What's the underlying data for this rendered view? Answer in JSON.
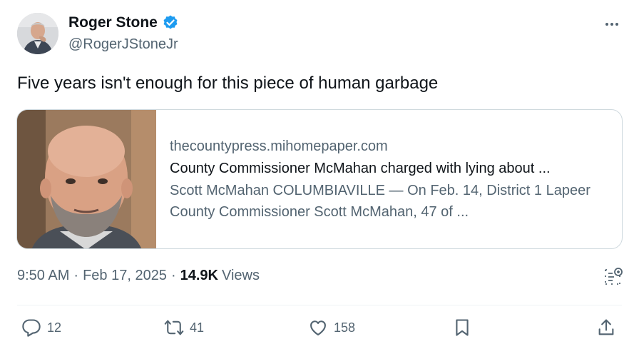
{
  "author": {
    "display_name": "Roger Stone",
    "handle": "@RogerJStoneJr",
    "avatar_icon": "profile-photo",
    "verified_icon": "verified-badge-icon",
    "verified_color": "#1d9bf0"
  },
  "tweet": {
    "text": "Five years isn't enough for this piece of human garbage"
  },
  "card": {
    "domain": "thecountypress.mihomepaper.com",
    "title": "County Commissioner McMahan charged with lying about ...",
    "description": "Scott McMahan COLUMBIAVILLE — On Feb. 14, District 1 Lapeer County Commissioner Scott McMahan, 47 of ..."
  },
  "meta": {
    "time": "9:50 AM",
    "separator": "·",
    "date": "Feb 17, 2025",
    "views_count": "14.9K",
    "views_label": "Views"
  },
  "actions": {
    "replies": "12",
    "reposts": "41",
    "likes": "158"
  },
  "colors": {
    "text_primary": "#0f1419",
    "text_secondary": "#536471",
    "border": "#cfd9de"
  }
}
